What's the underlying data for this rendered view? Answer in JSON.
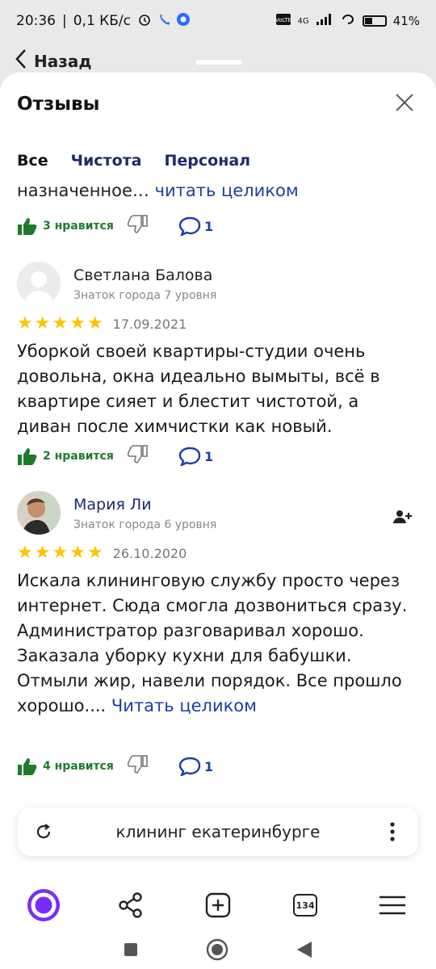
{
  "status": {
    "time": "20:36",
    "network_speed": "0,1 КБ/с",
    "network_type": "4G",
    "battery": "41%"
  },
  "nav": {
    "back_label": "Назад"
  },
  "sheet": {
    "title": "Отзывы"
  },
  "tabs": [
    {
      "label": "Все",
      "active": true
    },
    {
      "label": "Чистота",
      "active": false
    },
    {
      "label": "Персонал",
      "active": false
    }
  ],
  "previous_review": {
    "cut_text": "назначенное… ",
    "read_more": "читать целиком",
    "likes": "3 нравится",
    "comments": "1"
  },
  "reviews": [
    {
      "name": "Светлана Балова",
      "level": "Знаток города 7 уровня",
      "rating": 5,
      "date": "17.09.2021",
      "text": "Уборкой своей квартиры-студии очень довольна, окна идеально вымыты, всё в квартире сияет и блестит чистотой, а диван после химчистки как новый.",
      "likes": "2 нравится",
      "comments": "1"
    },
    {
      "name": "Мария Ли",
      "level": "Знаток города 6 уровня",
      "rating": 5,
      "date": "26.10.2020",
      "text": "Искала клининговую службу просто через интернет. Сюда смогла дозвониться сразу. Администратор разговаривал хорошо. Заказала уборку кухни для бабушки. Отмыли жир, навели порядок. Все прошло хорошо.... ",
      "read_more": "Читать целиком",
      "likes": "4 нравится",
      "comments": "1"
    }
  ],
  "search": {
    "query": "клининг екатеринбурге"
  },
  "toolbar": {
    "tabs_count": "134"
  },
  "icons": [
    "back-chevron-icon",
    "close-icon",
    "thumb-up-icon",
    "thumb-down-icon",
    "comment-icon",
    "star-icon",
    "add-user-icon",
    "reload-icon",
    "more-vert-icon",
    "alice-icon",
    "share-icon",
    "new-tab-icon",
    "tabs-icon",
    "menu-icon",
    "square-nav-icon",
    "circle-nav-icon",
    "triangle-back-icon"
  ],
  "colors": {
    "like_green": "#1e7b2e",
    "link_blue": "#1d3ea6",
    "star_yellow": "#ffc400",
    "alice_purple": "#7a2bff"
  }
}
